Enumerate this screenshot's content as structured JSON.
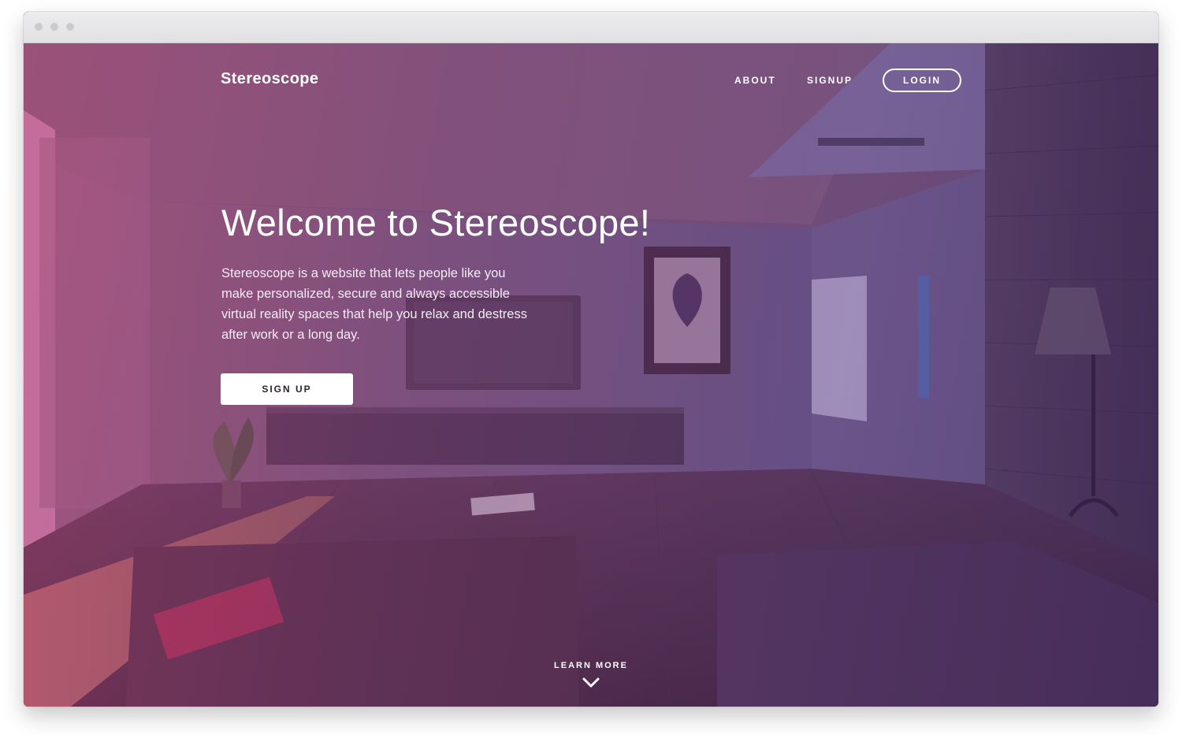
{
  "browser": {
    "window_controls": [
      "close-dot",
      "minimize-dot",
      "zoom-dot"
    ]
  },
  "nav": {
    "logo": "Stereoscope",
    "about": "ABOUT",
    "signup": "SIGNUP",
    "login": "LOGIN"
  },
  "hero": {
    "title": "Welcome to Stereoscope!",
    "description": "Stereoscope is a website that lets people like you make personalized, secure and always accessible virtual reality spaces that help you relax and destress after work or a long day.",
    "cta": "SIGN UP"
  },
  "footer": {
    "learn_more": "LEARN MORE",
    "icon": "chevron-down-icon"
  },
  "colors": {
    "overlay_pink": "#aa3c6e",
    "overlay_purple": "#372a5a",
    "text": "#ffffff",
    "button_text": "#2b2233"
  }
}
